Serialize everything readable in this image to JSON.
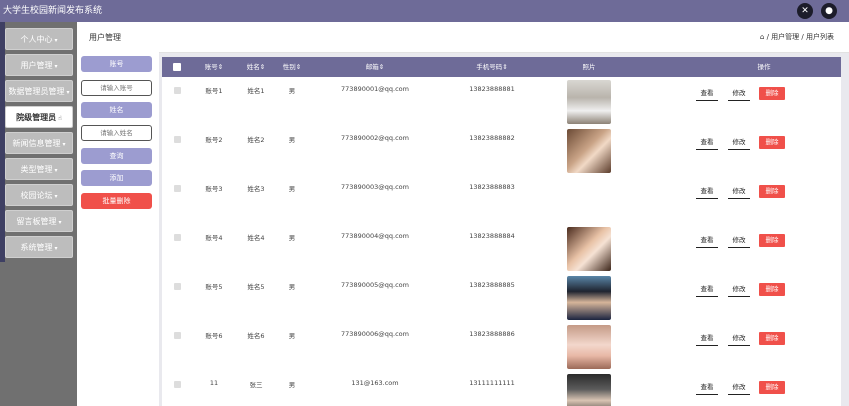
{
  "app": {
    "title": "大学生校园新闻发布系统"
  },
  "colors": {
    "accent": "#6e6b98",
    "danger": "#f0504a",
    "filter_button": "#9c9cd0",
    "sidebar": "#707070"
  },
  "top_icons": [
    "close-circle-icon",
    "user-avatar-icon"
  ],
  "sidebar": {
    "items": [
      {
        "label": "个人中心",
        "active": false
      },
      {
        "label": "用户管理",
        "active": false
      },
      {
        "label": "数据管理员管理",
        "active": false
      },
      {
        "label": "院级管理员",
        "active": true
      },
      {
        "label": "新闻信息管理",
        "active": false
      },
      {
        "label": "类型管理",
        "active": false
      },
      {
        "label": "校园论坛",
        "active": false
      },
      {
        "label": "留言板管理",
        "active": false
      },
      {
        "label": "系统管理",
        "active": false
      }
    ]
  },
  "header": {
    "page_title": "用户管理",
    "breadcrumb": "/ 用户管理 / 用户列表"
  },
  "filter": {
    "account_label": "账号",
    "account_placeholder": "请输入账号",
    "name_label": "姓名",
    "name_placeholder": "请输入姓名",
    "search_label": "查询",
    "add_label": "添加",
    "batch_delete_label": "批量删除"
  },
  "table": {
    "columns": [
      "账号",
      "姓名",
      "性别",
      "邮箱",
      "手机号码",
      "照片",
      "操作"
    ],
    "view_label": "查看",
    "edit_label": "修改",
    "delete_label": "删除",
    "rows": [
      {
        "account": "账号1",
        "name": "姓名1",
        "gender": "男",
        "email": "773890001@qq.com",
        "phone": "13823888881",
        "has_photo": true
      },
      {
        "account": "账号2",
        "name": "姓名2",
        "gender": "男",
        "email": "773890002@qq.com",
        "phone": "13823888882",
        "has_photo": true
      },
      {
        "account": "账号3",
        "name": "姓名3",
        "gender": "男",
        "email": "773890003@qq.com",
        "phone": "13823888883",
        "has_photo": false
      },
      {
        "account": "账号4",
        "name": "姓名4",
        "gender": "男",
        "email": "773890004@qq.com",
        "phone": "13823888884",
        "has_photo": true
      },
      {
        "account": "账号5",
        "name": "姓名5",
        "gender": "男",
        "email": "773890005@qq.com",
        "phone": "13823888885",
        "has_photo": true
      },
      {
        "account": "账号6",
        "name": "姓名6",
        "gender": "男",
        "email": "773890006@qq.com",
        "phone": "13823888886",
        "has_photo": true
      },
      {
        "account": "11",
        "name": "张三",
        "gender": "男",
        "email": "131@163.com",
        "phone": "13111111111",
        "has_photo": true
      }
    ]
  }
}
